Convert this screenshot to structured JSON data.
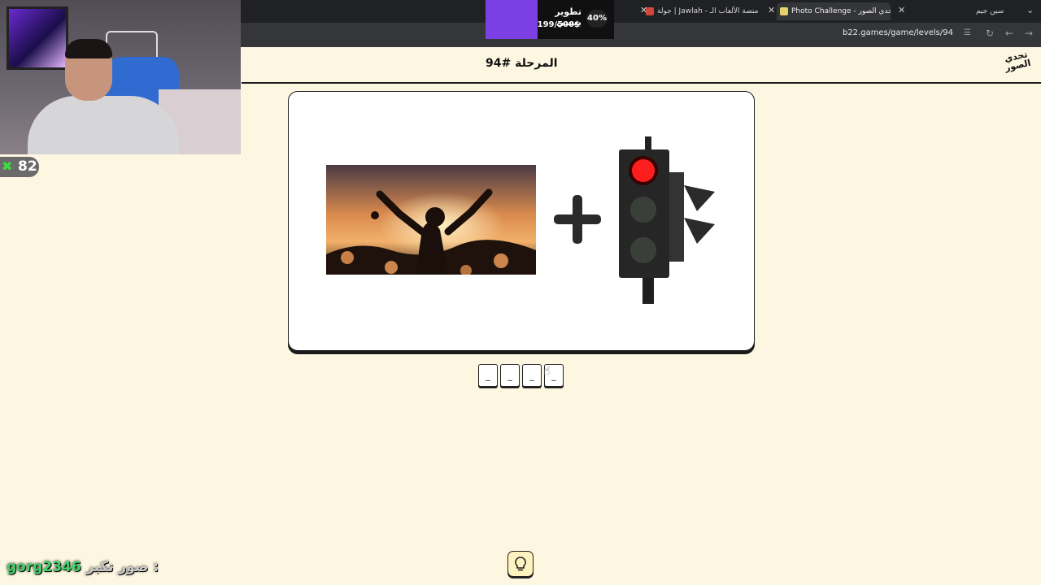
{
  "browser": {
    "tabs": [
      {
        "label": "Photo Challenge - تحدي الصور",
        "active": true
      },
      {
        "label": "جولة | Jawlah - منصة الألعاب الـ",
        "active": false
      },
      {
        "label": "سين جيم",
        "active": false
      }
    ],
    "url": "b22.games/game/levels/94"
  },
  "stream_overlay": {
    "goal_title": "تطوير بيسي",
    "goal_amount": "199/500$",
    "goal_percent": "40%",
    "counter_value": "82",
    "viewer_user": "gorg2346",
    "viewer_message": "صور تكبر :"
  },
  "page": {
    "level_title": "المرحلة #94",
    "logo_lines": [
      "تحدي",
      "الصور"
    ],
    "answer_slots": [
      "_",
      "_",
      "_",
      "_"
    ],
    "hint_icon": "lightbulb-icon"
  },
  "colors": {
    "background": "#fdf6e1",
    "card": "#ffffff",
    "outline": "#1a1a1a",
    "goal_purple": "#7b3fe4",
    "counter_green": "#3ce03c"
  }
}
